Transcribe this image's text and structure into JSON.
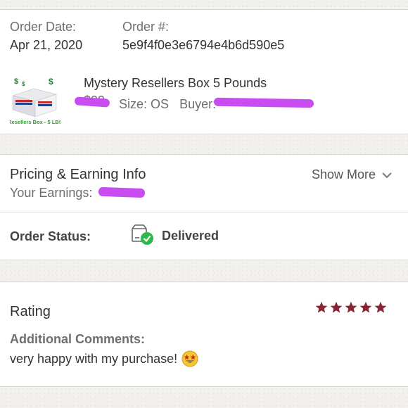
{
  "order": {
    "date_label": "Order Date:",
    "date_value": "Apr 21, 2020",
    "number_label": "Order #:",
    "number_value": "5e9f4f0e3e6794e4b6d590e5"
  },
  "item": {
    "title": "Mystery Resellers Box 5 Pounds",
    "price_partial": "$99",
    "size_text": "Size: OS",
    "buyer_label": "Buyer:",
    "thumbnail_caption": "Resellers Box - 5 LBS",
    "thumbnail_dollar_signs": "$ $ $"
  },
  "pricing": {
    "title": "Pricing & Earning Info",
    "show_more": "Show More",
    "earnings_label": "Your Earnings:"
  },
  "status": {
    "label": "Order Status:",
    "value": "Delivered"
  },
  "rating": {
    "title": "Rating",
    "stars": 5,
    "max_stars": 5,
    "comments_label": "Additional Comments:",
    "comments_value": "very happy with my purchase!"
  },
  "colors": {
    "star": "#8b2434",
    "delivered_check": "#2eb84b",
    "redaction": "#c84cf0",
    "thumb_caption": "#2a9a2a"
  },
  "icons": {
    "chevron": "chevron-down-icon",
    "status": "delivered-box-icon",
    "emoji": "star-struck-emoji-icon",
    "star": "star-icon"
  }
}
